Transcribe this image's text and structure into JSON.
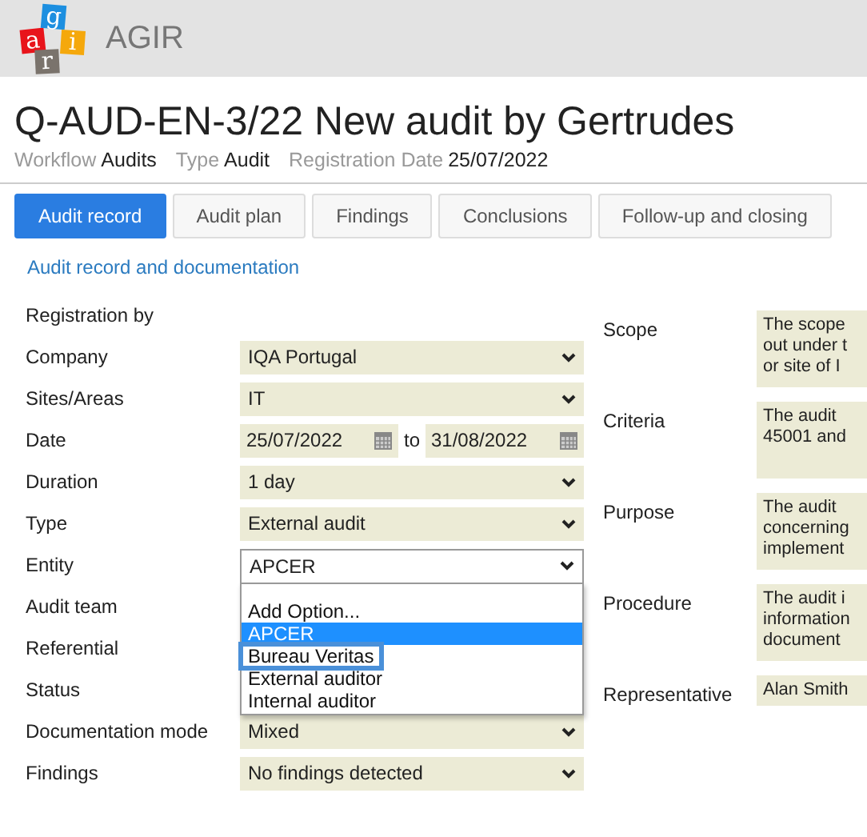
{
  "app": {
    "logo_letters": [
      "a",
      "g",
      "r",
      "i"
    ],
    "name": "AGIR"
  },
  "record": {
    "title": "Q-AUD-EN-3/22 New audit by Gertrudes",
    "meta": [
      {
        "label": "Workflow",
        "value": "Audits"
      },
      {
        "label": "Type",
        "value": "Audit"
      },
      {
        "label": "Registration Date",
        "value": "25/07/2022"
      }
    ]
  },
  "tabs": [
    {
      "label": "Audit record",
      "selected": true
    },
    {
      "label": "Audit plan",
      "selected": false
    },
    {
      "label": "Findings",
      "selected": false
    },
    {
      "label": "Conclusions",
      "selected": false
    },
    {
      "label": "Follow-up and closing",
      "selected": false
    }
  ],
  "section_link": "Audit record and documentation",
  "fields": [
    {
      "label": "Registration by",
      "kind": "label"
    },
    {
      "label": "Company",
      "kind": "select",
      "value": "IQA Portugal"
    },
    {
      "label": "Sites/Areas",
      "kind": "select",
      "value": "IT"
    },
    {
      "label": "Date",
      "kind": "daterange",
      "from": "25/07/2022",
      "separator": "to",
      "to": "31/08/2022"
    },
    {
      "label": "Duration",
      "kind": "select",
      "value": "1 day"
    },
    {
      "label": "Type",
      "kind": "select",
      "value": "External audit"
    },
    {
      "label": "Entity",
      "kind": "select",
      "value": "APCER",
      "open": true
    },
    {
      "label": "Audit team",
      "kind": "label"
    },
    {
      "label": "Referential",
      "kind": "label"
    },
    {
      "label": "Status",
      "kind": "label"
    },
    {
      "label": "Documentation mode",
      "kind": "select",
      "value": "Mixed"
    },
    {
      "label": "Findings",
      "kind": "select",
      "value": "No findings detected"
    }
  ],
  "entity_options": [
    {
      "label": "Add Option...",
      "selected": false,
      "focused": false
    },
    {
      "label": "APCER",
      "selected": true,
      "focused": false
    },
    {
      "label": "Bureau Veritas",
      "selected": false,
      "focused": true
    },
    {
      "label": "External auditor",
      "selected": false,
      "focused": false
    },
    {
      "label": "Internal auditor",
      "selected": false,
      "focused": false
    }
  ],
  "details": [
    {
      "label": "Scope",
      "lines": [
        "The scope",
        "out under t",
        "or site of I"
      ]
    },
    {
      "label": "Criteria",
      "lines": [
        "The audit",
        "45001 and"
      ]
    },
    {
      "label": "Purpose",
      "lines": [
        "The audit",
        "concerning",
        "implement"
      ]
    },
    {
      "label": "Procedure",
      "lines": [
        "The audit i",
        "information",
        "document"
      ]
    },
    {
      "label": "Representative",
      "lines": [
        "Alan Smith"
      ]
    }
  ]
}
